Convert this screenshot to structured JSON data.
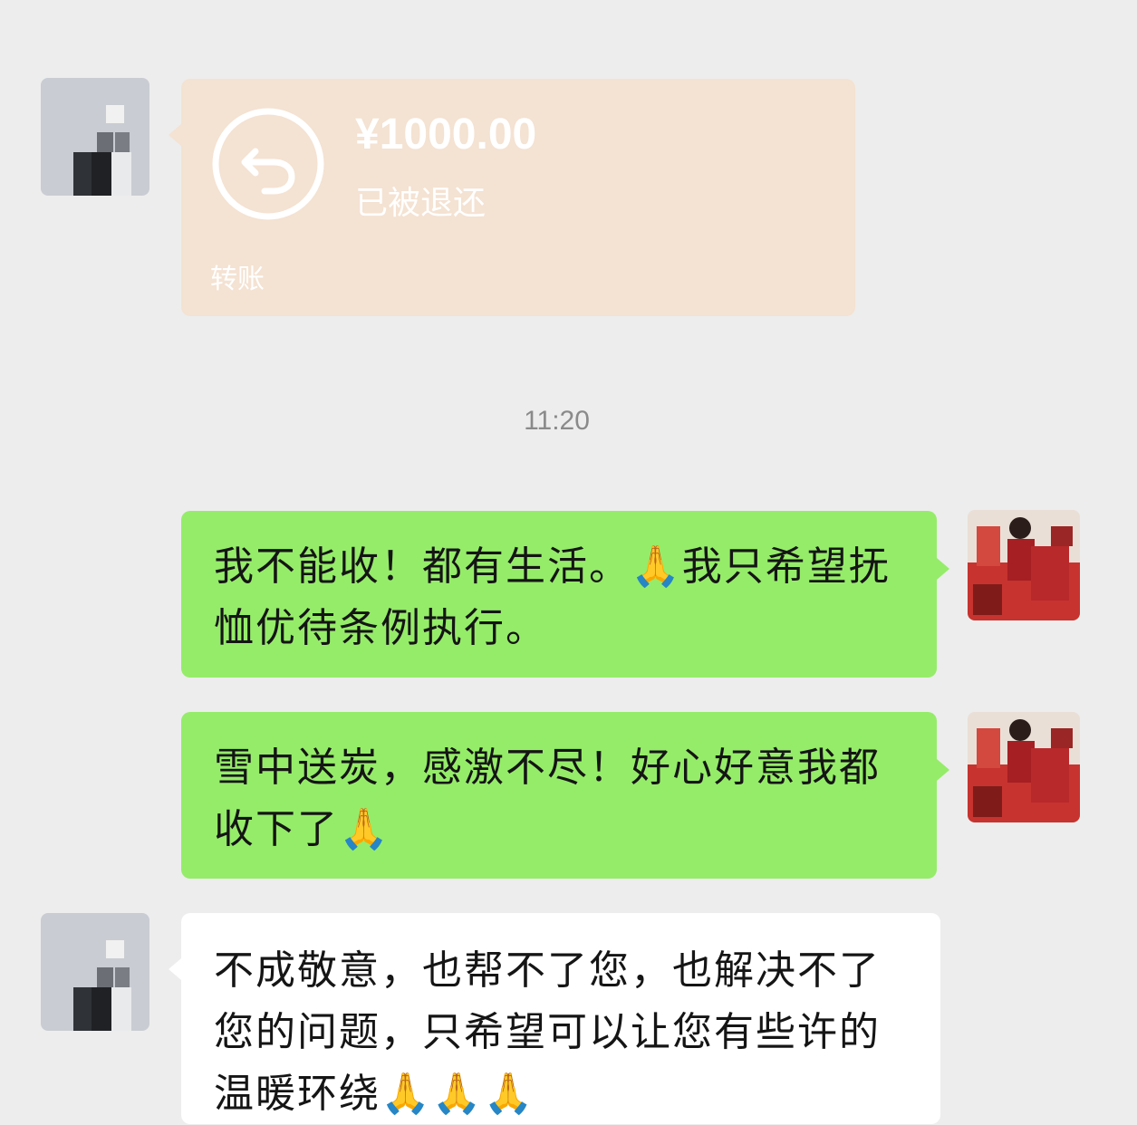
{
  "chat": {
    "time_separator": "11:20",
    "transfer": {
      "amount": "¥1000.00",
      "status": "已被退还",
      "footer": "转账",
      "icon": "return-arrow-icon"
    },
    "messages": [
      {
        "side": "right",
        "text": "我不能收！都有生活。🙏我只希望抚恤优待条例执行。"
      },
      {
        "side": "right",
        "text": "雪中送炭，感激不尽！好心好意我都收下了🙏"
      },
      {
        "side": "left",
        "text": "不成敬意，也帮不了您，也解决不了您的问题，只希望可以让您有些许的温暖环绕🙏🙏🙏"
      }
    ]
  },
  "colors": {
    "background": "#ededed",
    "outgoing_bubble": "#95ec69",
    "incoming_bubble": "#ffffff",
    "transfer_bubble": "#f4e2d2"
  }
}
